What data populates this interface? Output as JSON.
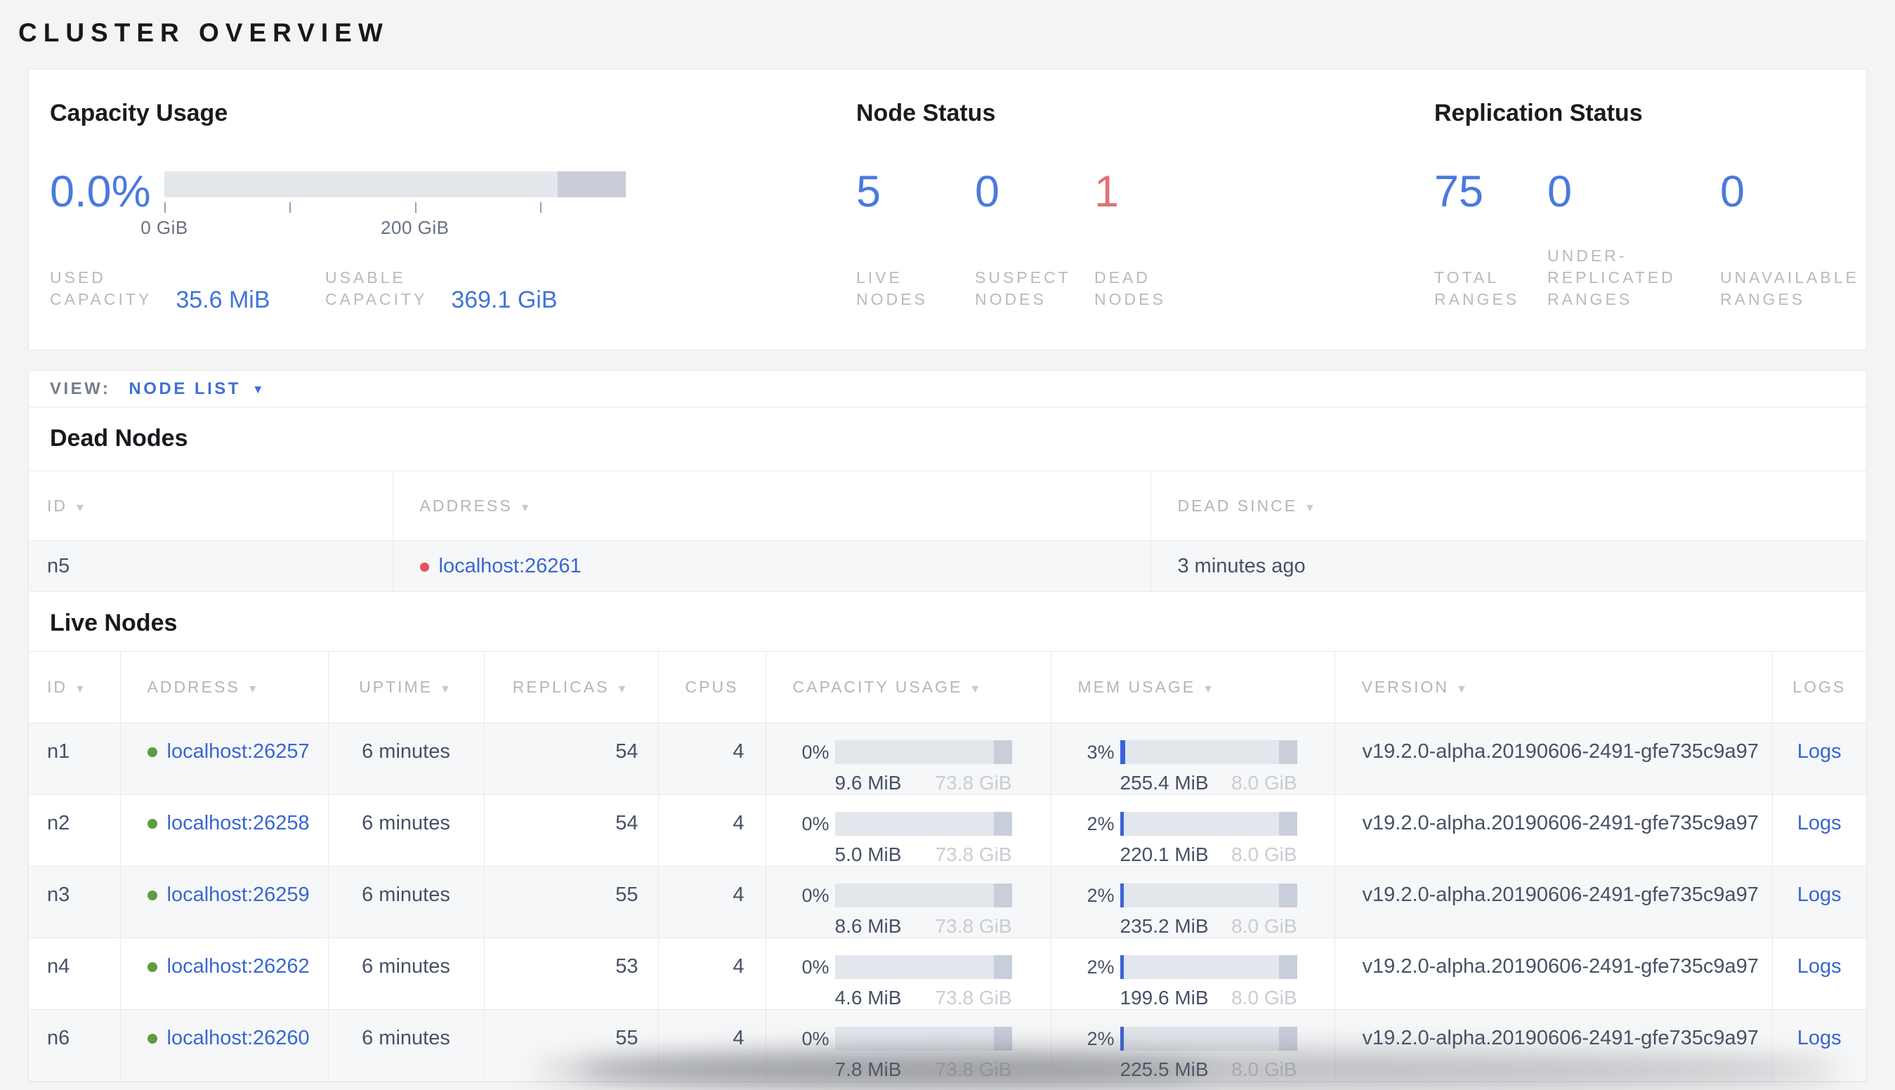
{
  "title": "CLUSTER OVERVIEW",
  "colors": {
    "accent_blue": "#4a79de",
    "link_blue": "#3866d2",
    "dead_red": "#df7378",
    "live_dot_green": "#609b40",
    "dead_dot_red": "#e0565c",
    "bar_track": "#e3e6ed",
    "bar_reserved": "#c9cedb",
    "bar_fill_blue": "#3c61d8"
  },
  "capacity": {
    "heading": "Capacity Usage",
    "percent": "0.0%",
    "bar": {
      "reserved_from_pct": 85.3,
      "ticks": [
        {
          "pos": 0,
          "label": "0 GiB"
        },
        {
          "pos": 27.15,
          "label": ""
        },
        {
          "pos": 54.3,
          "label": "200 GiB"
        },
        {
          "pos": 81.45,
          "label": ""
        }
      ]
    },
    "stats": [
      {
        "lines": [
          "USED",
          "CAPACITY"
        ],
        "value": "35.6 MiB"
      },
      {
        "lines": [
          "USABLE",
          "CAPACITY"
        ],
        "value": "369.1 GiB"
      }
    ]
  },
  "node_status": {
    "heading": "Node Status",
    "stats": [
      {
        "value": "5",
        "tone": "blue",
        "lines": [
          "LIVE",
          "NODES"
        ]
      },
      {
        "value": "0",
        "tone": "blue",
        "lines": [
          "SUSPECT",
          "NODES"
        ]
      },
      {
        "value": "1",
        "tone": "red",
        "lines": [
          "DEAD",
          "NODES"
        ]
      }
    ]
  },
  "replication": {
    "heading": "Replication Status",
    "stats": [
      {
        "value": "75",
        "tone": "blue",
        "lines": [
          "TOTAL",
          "RANGES"
        ]
      },
      {
        "value": "0",
        "tone": "blue",
        "lines": [
          "UNDER-",
          "REPLICATED",
          "RANGES"
        ]
      },
      {
        "value": "0",
        "tone": "blue",
        "lines": [
          "UNAVAILABLE",
          "RANGES"
        ]
      }
    ]
  },
  "view_bar": {
    "label": "VIEW:",
    "selected": "NODE LIST"
  },
  "dead_section": {
    "heading": "Dead Nodes",
    "headers": [
      {
        "label": "ID",
        "sort": true
      },
      {
        "label": "ADDRESS",
        "sort": true
      },
      {
        "label": "DEAD SINCE",
        "sort": true
      }
    ],
    "rows": [
      {
        "id": "n5",
        "address": "localhost:26261",
        "status": "dead",
        "dead_since": "3 minutes ago"
      }
    ]
  },
  "live_section": {
    "heading": "Live Nodes",
    "headers": [
      {
        "label": "ID",
        "sort": true
      },
      {
        "label": "ADDRESS",
        "sort": true
      },
      {
        "label": "UPTIME",
        "sort": true
      },
      {
        "label": "REPLICAS",
        "sort": true
      },
      {
        "label": "CPUS",
        "sort": false
      },
      {
        "label": "CAPACITY USAGE",
        "sort": true
      },
      {
        "label": "MEM USAGE",
        "sort": true
      },
      {
        "label": "VERSION",
        "sort": true
      },
      {
        "label": "LOGS",
        "sort": false
      }
    ],
    "rows": [
      {
        "id": "n1",
        "address": "localhost:26257",
        "status": "live",
        "uptime": "6 minutes",
        "replicas": "54",
        "cpus": "4",
        "capacity": {
          "pct": "0%",
          "fill": 0,
          "used": "9.6 MiB",
          "total": "73.8 GiB"
        },
        "mem": {
          "pct": "3%",
          "fill": 3,
          "used": "255.4 MiB",
          "total": "8.0 GiB"
        },
        "version": "v19.2.0-alpha.20190606-2491-gfe735c9a97",
        "logs": "Logs"
      },
      {
        "id": "n2",
        "address": "localhost:26258",
        "status": "live",
        "uptime": "6 minutes",
        "replicas": "54",
        "cpus": "4",
        "capacity": {
          "pct": "0%",
          "fill": 0,
          "used": "5.0 MiB",
          "total": "73.8 GiB"
        },
        "mem": {
          "pct": "2%",
          "fill": 2,
          "used": "220.1 MiB",
          "total": "8.0 GiB"
        },
        "version": "v19.2.0-alpha.20190606-2491-gfe735c9a97",
        "logs": "Logs"
      },
      {
        "id": "n3",
        "address": "localhost:26259",
        "status": "live",
        "uptime": "6 minutes",
        "replicas": "55",
        "cpus": "4",
        "capacity": {
          "pct": "0%",
          "fill": 0,
          "used": "8.6 MiB",
          "total": "73.8 GiB"
        },
        "mem": {
          "pct": "2%",
          "fill": 2,
          "used": "235.2 MiB",
          "total": "8.0 GiB"
        },
        "version": "v19.2.0-alpha.20190606-2491-gfe735c9a97",
        "logs": "Logs"
      },
      {
        "id": "n4",
        "address": "localhost:26262",
        "status": "live",
        "uptime": "6 minutes",
        "replicas": "53",
        "cpus": "4",
        "capacity": {
          "pct": "0%",
          "fill": 0,
          "used": "4.6 MiB",
          "total": "73.8 GiB"
        },
        "mem": {
          "pct": "2%",
          "fill": 2,
          "used": "199.6 MiB",
          "total": "8.0 GiB"
        },
        "version": "v19.2.0-alpha.20190606-2491-gfe735c9a97",
        "logs": "Logs"
      },
      {
        "id": "n6",
        "address": "localhost:26260",
        "status": "live",
        "uptime": "6 minutes",
        "replicas": "55",
        "cpus": "4",
        "capacity": {
          "pct": "0%",
          "fill": 0,
          "used": "7.8 MiB",
          "total": "73.8 GiB"
        },
        "mem": {
          "pct": "2%",
          "fill": 2,
          "used": "225.5 MiB",
          "total": "8.0 GiB"
        },
        "version": "v19.2.0-alpha.20190606-2491-gfe735c9a97",
        "logs": "Logs"
      }
    ]
  }
}
